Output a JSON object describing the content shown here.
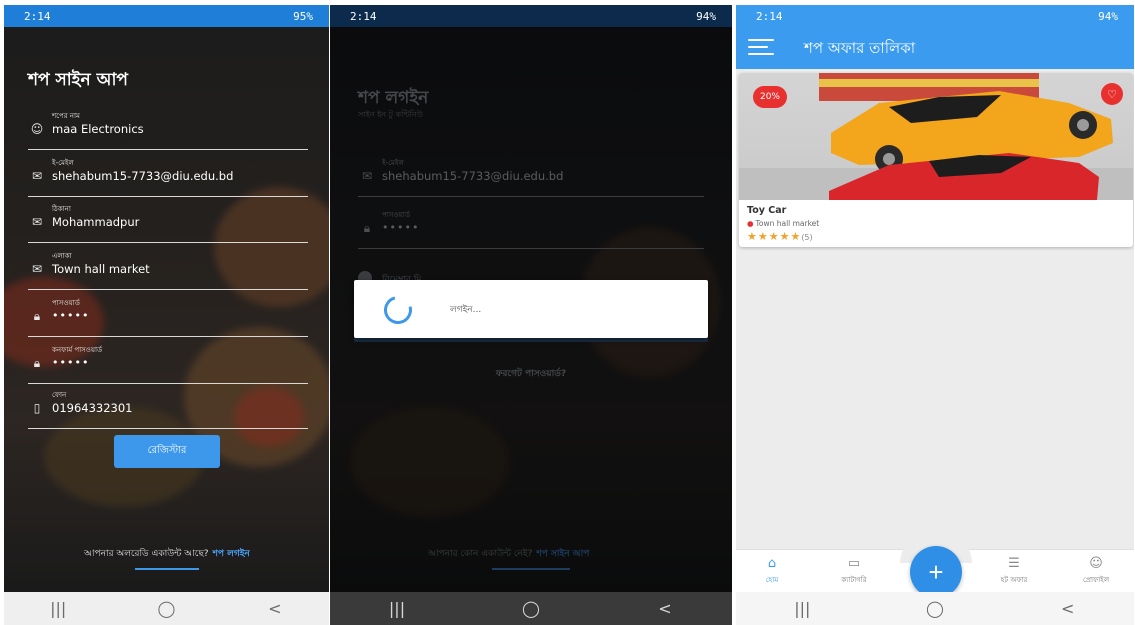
{
  "signup": {
    "status_time": "2:14",
    "status_battery": "95%",
    "title": "শপ সাইন আপ",
    "fields": [
      {
        "label": "শপের নাম",
        "value": "maa Electronics",
        "icon": "person-icon"
      },
      {
        "label": "ই-মেইল",
        "value": "shehabum15-7733@diu.edu.bd",
        "icon": "mail-icon"
      },
      {
        "label": "ঠিকানা",
        "value": "Mohammadpur",
        "icon": "mail-icon"
      },
      {
        "label": "এলাকা",
        "value": "Town hall market",
        "icon": "mail-icon"
      },
      {
        "label": "পাসওয়ার্ড",
        "value": "•••••",
        "icon": "lock-icon"
      },
      {
        "label": "কনফার্ম পাসওয়ার্ড",
        "value": "•••••",
        "icon": "lock-icon"
      },
      {
        "label": "ফোন",
        "value": "01964332301",
        "icon": "phone-icon"
      }
    ],
    "register_label": "রেজিস্টার",
    "footer_text": "আপনার অলরেডি একাউন্ট আছে?",
    "footer_link": "শপ লগইন"
  },
  "login": {
    "status_time": "2:14",
    "status_battery": "94%",
    "title": "শপ লগইন",
    "subtitle": "সাইন ইন টু কন্টিনিউ",
    "email_label": "ই-মেইল",
    "email_value": "shehabum15-7733@diu.edu.bd",
    "password_label": "পাসওয়ার্ড",
    "password_value": "•••••",
    "remember_label": "রিমেম্বার মি",
    "forgot_label": "ফরগেট পাসওয়ার্ড?",
    "dialog_text": "লগইন...",
    "footer_text": "আপনার কোন একাউন্ট নেই?",
    "footer_link": "শপ সাইন আপ"
  },
  "offers": {
    "status_time": "2:14",
    "status_battery": "94%",
    "title": "শপ অফার তালিকা",
    "product": {
      "discount": "20%",
      "name": "Toy Car",
      "location": "Town hall market",
      "stars": "★★★★★",
      "rating_count": "(5)"
    },
    "nav": [
      {
        "label": "হোম",
        "icon": "home-icon"
      },
      {
        "label": "ক্যাটাগরি",
        "icon": "category-icon"
      },
      {
        "label": "হট অফার",
        "icon": "offer-icon"
      },
      {
        "label": "প্রোফাইল",
        "icon": "profile-icon"
      }
    ],
    "fab_label": "+"
  },
  "system_nav": {
    "recent": "|||",
    "home": "◯",
    "back": "<"
  },
  "colors": {
    "accent": "#3d97ea",
    "badge": "#e8302f",
    "star": "#f2a12a"
  }
}
